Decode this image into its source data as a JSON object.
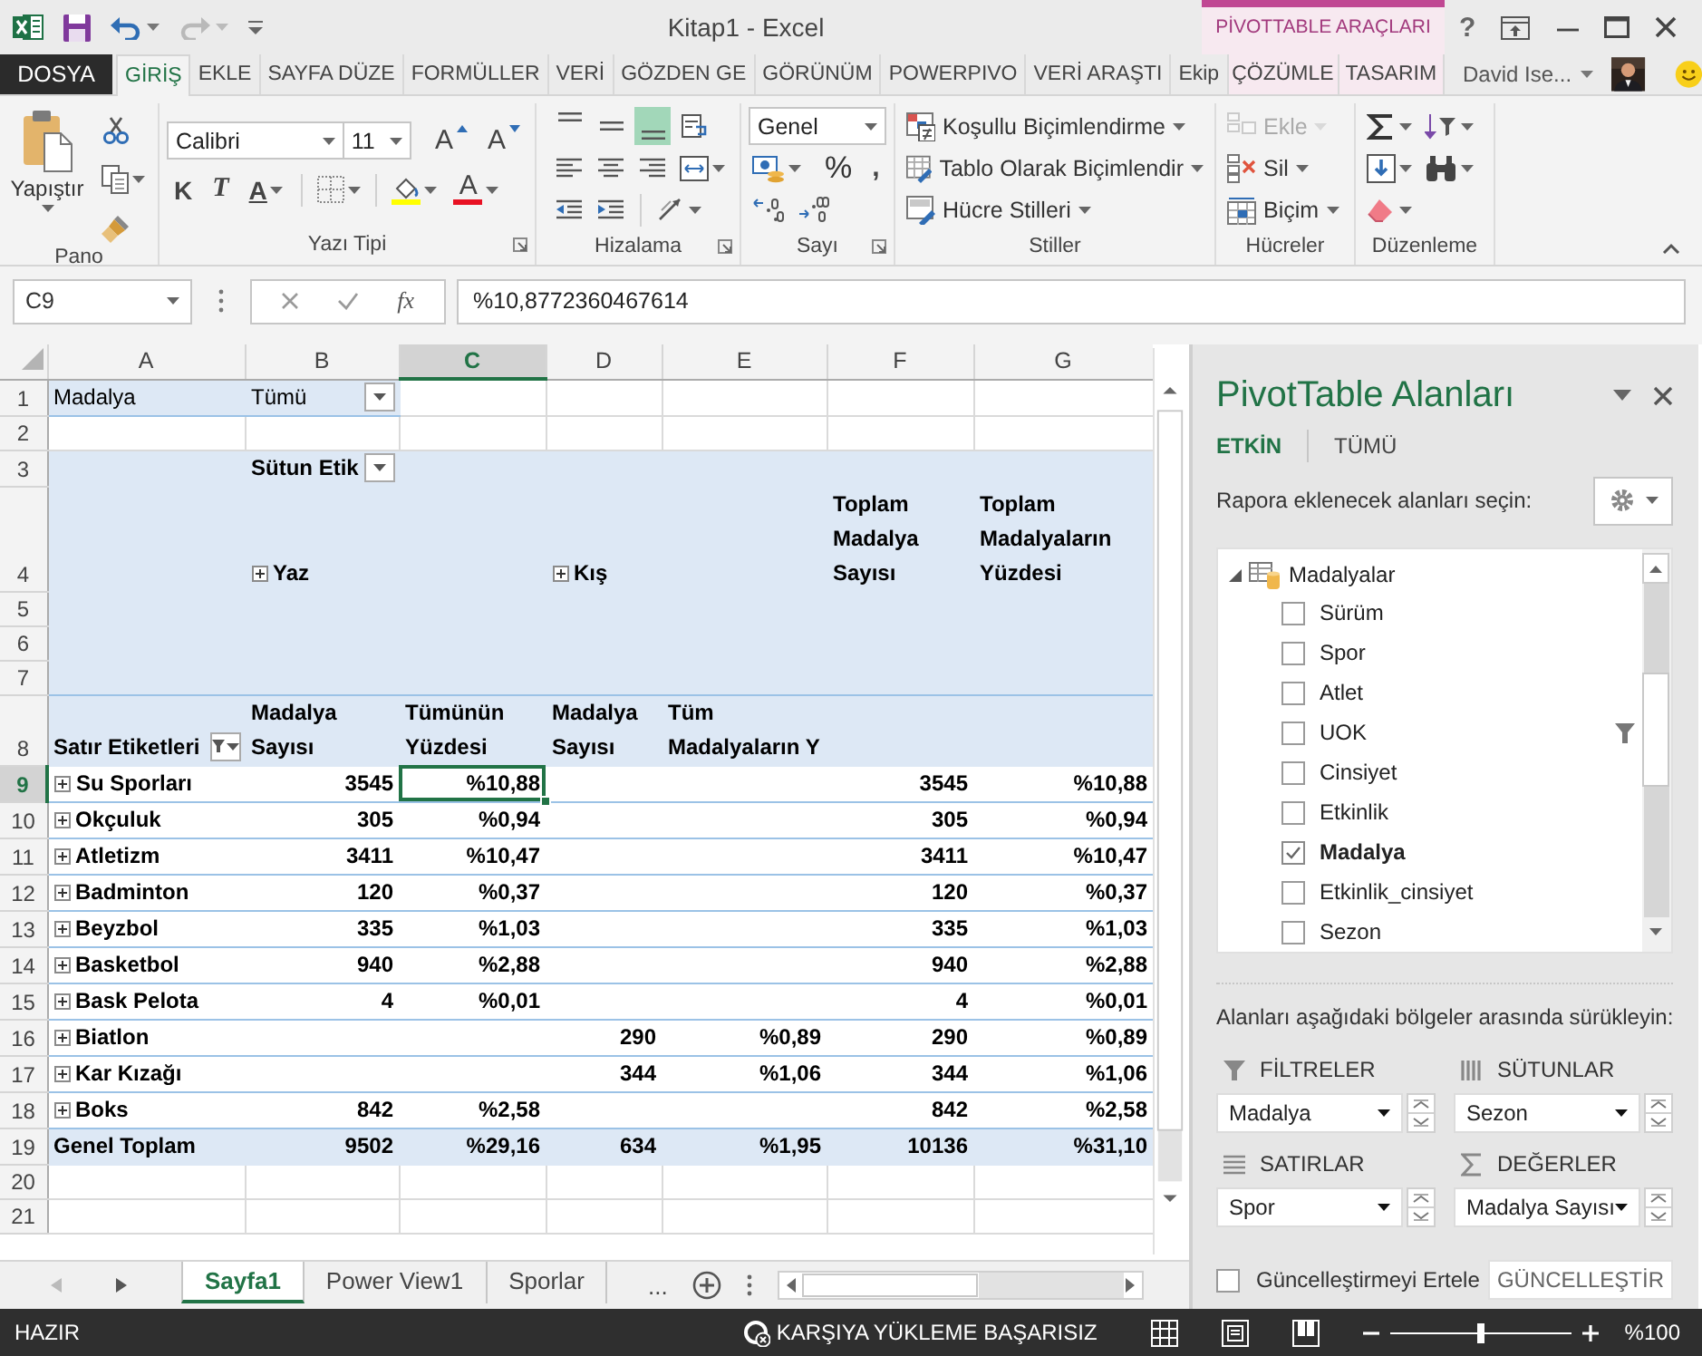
{
  "window": {
    "title": "Kitap1 - Excel",
    "context_title": "PİVOTTABLE ARAÇLARI",
    "help": "?"
  },
  "ribbon_tabs": [
    {
      "label": "DOSYA",
      "kind": "file",
      "selected": false
    },
    {
      "label": "GİRİŞ",
      "kind": "normal",
      "selected": true
    },
    {
      "label": "EKLE",
      "kind": "normal",
      "selected": false
    },
    {
      "label": "SAYFA DÜZE",
      "kind": "normal",
      "selected": false
    },
    {
      "label": "FORMÜLLER",
      "kind": "normal",
      "selected": false
    },
    {
      "label": "VERİ",
      "kind": "normal",
      "selected": false
    },
    {
      "label": "GÖZDEN GE",
      "kind": "normal",
      "selected": false
    },
    {
      "label": "GÖRÜNÜM",
      "kind": "normal",
      "selected": false
    },
    {
      "label": "POWERPIVO",
      "kind": "normal",
      "selected": false
    },
    {
      "label": "VERİ ARAŞTI",
      "kind": "normal",
      "selected": false
    },
    {
      "label": "Ekip",
      "kind": "normal",
      "selected": false
    },
    {
      "label": "ÇÖZÜMLE",
      "kind": "context",
      "selected": false
    },
    {
      "label": "TASARIM",
      "kind": "context",
      "selected": false
    }
  ],
  "account": {
    "user": "David Ise..."
  },
  "ribbon_groups": [
    {
      "kind": "clipboard",
      "label": "Pano",
      "paste": "Yapıştır"
    },
    {
      "kind": "font",
      "label": "Yazı Tipi",
      "font": "Calibri",
      "size": "11",
      "grow": "A",
      "shrink": "A",
      "bold": "K",
      "italic": "T",
      "underline": "A",
      "font_color": "A"
    },
    {
      "kind": "alignment",
      "label": "Hizalama",
      "vertical": [
        {
          "selected": false
        },
        {
          "selected": false
        },
        {
          "selected": true
        }
      ]
    },
    {
      "kind": "number",
      "label": "Sayı",
      "format": "Genel",
      "percent": "%",
      "comma": ","
    },
    {
      "kind": "styles",
      "label": "Stiller",
      "buttons": [
        "Koşullu Biçimlendirme",
        "Tablo Olarak Biçimlendir",
        "Hücre Stilleri"
      ]
    },
    {
      "kind": "cells",
      "label": "Hücreler",
      "buttons": [
        {
          "label": "Ekle",
          "disabled": true
        },
        {
          "label": "Sil",
          "disabled": false
        },
        {
          "label": "Biçim",
          "disabled": false
        }
      ]
    },
    {
      "kind": "editing",
      "label": "Düzenleme"
    }
  ],
  "formula_bar": {
    "name_box": "C9",
    "function_button": "fx",
    "value": "%10,8772360467614"
  },
  "sheet": {
    "columns": [
      {
        "label": "A",
        "selected": false
      },
      {
        "label": "B",
        "selected": false
      },
      {
        "label": "C",
        "selected": true
      },
      {
        "label": "D",
        "selected": false
      },
      {
        "label": "E",
        "selected": false
      },
      {
        "label": "F",
        "selected": false
      },
      {
        "label": "G",
        "selected": false
      }
    ],
    "rows": [
      {
        "number": "1",
        "kind": "filter",
        "selected": false,
        "a": "Madalya",
        "b": {
          "text": "Tümü",
          "kind": "dropdown"
        }
      },
      {
        "number": "2",
        "kind": "blank",
        "selected": false
      },
      {
        "number": "3",
        "kind": "header",
        "selected": false,
        "b": {
          "text": "Sütun Etik",
          "kind": "dropdown"
        }
      },
      {
        "number": "4",
        "kind": "header",
        "selected": false,
        "b": {
          "text": "Yaz",
          "kind": "expand"
        },
        "d": {
          "text": "Kış",
          "kind": "expand"
        },
        "f": "Toplam Madalya Sayısı",
        "g": "Toplam Madalyaların Yüzdesi"
      },
      {
        "number": "5",
        "kind": "header",
        "selected": false
      },
      {
        "number": "6",
        "kind": "header",
        "selected": false
      },
      {
        "number": "7",
        "kind": "header",
        "selected": false
      },
      {
        "number": "8",
        "kind": "header",
        "selected": false,
        "a": {
          "text": "Satır Etiketleri",
          "kind": "filter"
        },
        "b": "Madalya Sayısı",
        "c": "Tümünün Yüzdesi",
        "d": "Madalya Sayısı",
        "e": "Tüm Madalyaların Y"
      },
      {
        "number": "9",
        "kind": "data",
        "selected": true,
        "a": {
          "text": "Su Sporları",
          "kind": "expand"
        },
        "b": "3545",
        "c": "%10,88",
        "f": "3545",
        "g": "%10,88"
      },
      {
        "number": "10",
        "kind": "data",
        "selected": false,
        "a": {
          "text": "Okçuluk",
          "kind": "expand"
        },
        "b": "305",
        "c": "%0,94",
        "f": "305",
        "g": "%0,94"
      },
      {
        "number": "11",
        "kind": "data",
        "selected": false,
        "a": {
          "text": "Atletizm",
          "kind": "expand"
        },
        "b": "3411",
        "c": "%10,47",
        "f": "3411",
        "g": "%10,47"
      },
      {
        "number": "12",
        "kind": "data",
        "selected": false,
        "a": {
          "text": "Badminton",
          "kind": "expand"
        },
        "b": "120",
        "c": "%0,37",
        "f": "120",
        "g": "%0,37"
      },
      {
        "number": "13",
        "kind": "data",
        "selected": false,
        "a": {
          "text": "Beyzbol",
          "kind": "expand"
        },
        "b": "335",
        "c": "%1,03",
        "f": "335",
        "g": "%1,03"
      },
      {
        "number": "14",
        "kind": "data",
        "selected": false,
        "a": {
          "text": "Basketbol",
          "kind": "expand"
        },
        "b": "940",
        "c": "%2,88",
        "f": "940",
        "g": "%2,88"
      },
      {
        "number": "15",
        "kind": "data",
        "selected": false,
        "a": {
          "text": "Bask Pelota",
          "kind": "expand"
        },
        "b": "4",
        "c": "%0,01",
        "f": "4",
        "g": "%0,01"
      },
      {
        "number": "16",
        "kind": "data",
        "selected": false,
        "a": {
          "text": "Biatlon",
          "kind": "expand"
        },
        "d": "290",
        "e": "%0,89",
        "f": "290",
        "g": "%0,89"
      },
      {
        "number": "17",
        "kind": "data",
        "selected": false,
        "a": {
          "text": "Kar Kızağı",
          "kind": "expand"
        },
        "d": "344",
        "e": "%1,06",
        "f": "344",
        "g": "%1,06"
      },
      {
        "number": "18",
        "kind": "data",
        "selected": false,
        "a": {
          "text": "Boks",
          "kind": "expand"
        },
        "b": "842",
        "c": "%2,58",
        "f": "842",
        "g": "%2,58"
      },
      {
        "number": "19",
        "kind": "total",
        "selected": false,
        "a": "Genel Toplam",
        "b": "9502",
        "c": "%29,16",
        "d": "634",
        "e": "%1,95",
        "f": "10136",
        "g": "%31,10"
      },
      {
        "number": "20",
        "kind": "empty",
        "selected": false
      },
      {
        "number": "21",
        "kind": "empty",
        "selected": false
      }
    ]
  },
  "sheet_tabs": [
    {
      "label": "Sayfa1",
      "selected": true
    },
    {
      "label": "Power View1",
      "selected": false
    },
    {
      "label": "Sporlar",
      "selected": false
    }
  ],
  "more_sheets": "...",
  "pivot_pane": {
    "title": "PivotTable Alanları",
    "tabs": [
      {
        "label": "ETKİN",
        "selected": true
      },
      {
        "label": "TÜMÜ",
        "selected": false
      }
    ],
    "prompt": "Rapora eklenecek alanları seçin:",
    "fields": [
      {
        "label": "Madalyalar",
        "expanded": true,
        "children": [
          {
            "label": "Sürüm",
            "checked": false,
            "filtered": false
          },
          {
            "label": "Spor",
            "checked": false,
            "filtered": false
          },
          {
            "label": "Atlet",
            "checked": false,
            "filtered": false
          },
          {
            "label": "UOK",
            "checked": false,
            "filtered": true
          },
          {
            "label": "Cinsiyet",
            "checked": false,
            "filtered": false
          },
          {
            "label": "Etkinlik",
            "checked": false,
            "filtered": false
          },
          {
            "label": "Madalya",
            "checked": true,
            "filtered": false
          },
          {
            "label": "Etkinlik_cinsiyet",
            "checked": false,
            "filtered": false
          },
          {
            "label": "Sezon",
            "checked": false,
            "filtered": false
          }
        ]
      }
    ],
    "drag_hint": "Alanları aşağıdaki bölgeler arasında sürükleyin:",
    "areas": [
      {
        "kind": "filters",
        "label": "FİLTRELER",
        "field": "Madalya"
      },
      {
        "kind": "columns",
        "label": "SÜTUNLAR",
        "field": "Sezon"
      },
      {
        "kind": "rows",
        "label": "SATIRLAR",
        "field": "Spor"
      },
      {
        "kind": "values",
        "label": "DEĞERLER",
        "field": "Madalya Sayısı"
      }
    ],
    "defer": {
      "label": "Güncelleştirmeyi Ertele",
      "checked": false
    },
    "update_button": "GÜNCELLEŞTİR"
  },
  "status_bar": {
    "status": "HAZIR",
    "upload": "KARŞIYA YÜKLEME BAŞARISIZ",
    "zoom": {
      "label": "%100",
      "level": 0.5
    }
  }
}
